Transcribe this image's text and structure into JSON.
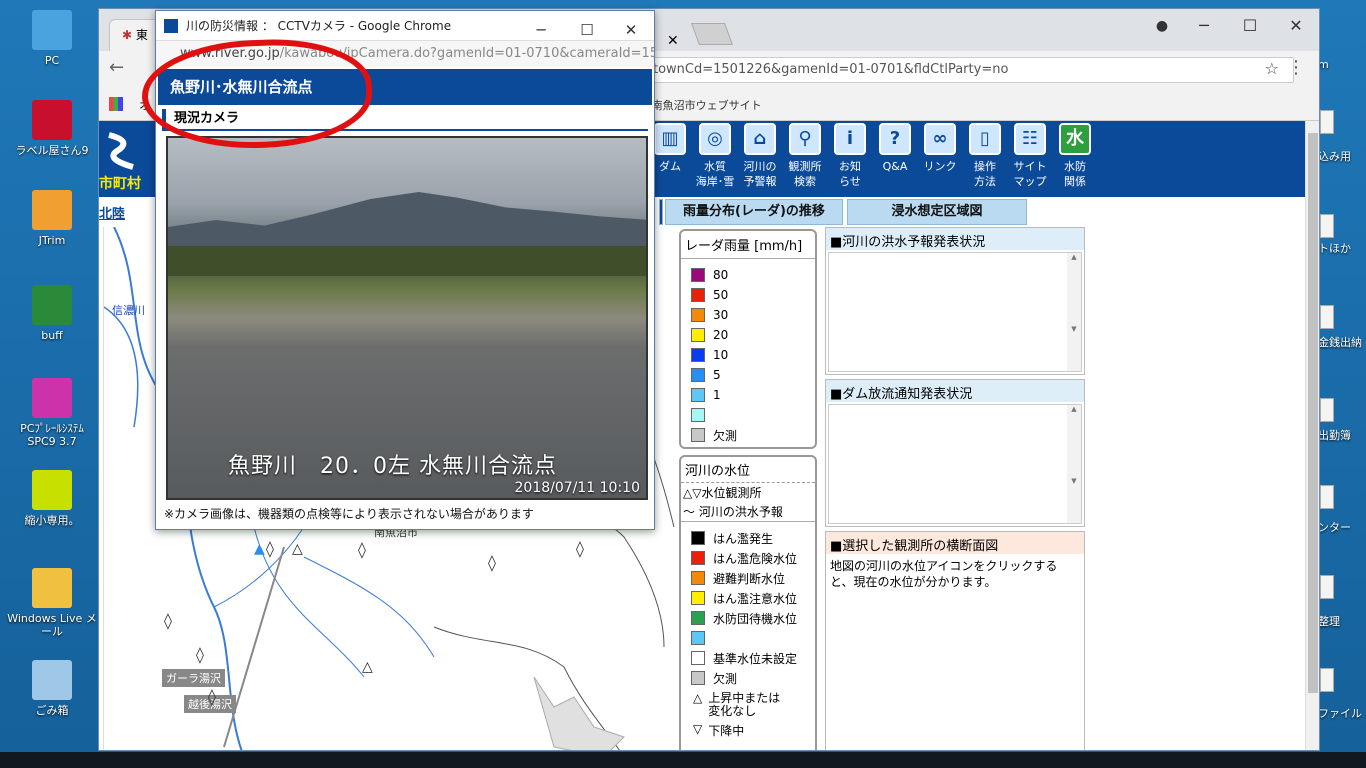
{
  "desktop": {
    "icons": [
      {
        "label": "PC",
        "color": "#4aa3df"
      },
      {
        "label": "ラベル屋さん9",
        "color": "#c8102e"
      },
      {
        "label": "JTrim",
        "color": "#f0a030"
      },
      {
        "label": "buff",
        "color": "#2a8a3a"
      },
      {
        "label": "PCﾌﾟﾚｰﾙｼｽﾃﾑ SPC9 3.7",
        "color": "#cc33aa"
      },
      {
        "label": "縮小専用。",
        "color": "#c8e000"
      },
      {
        "label": "Windows Live メール",
        "color": "#f0c040"
      },
      {
        "label": "ごみ箱",
        "color": "#9ec7e8"
      }
    ],
    "right_labels": [
      "込み用",
      "トほか",
      "金銭出納",
      "出勤簿",
      "ンター",
      "整理",
      "ファイル",
      "m"
    ]
  },
  "browser": {
    "tab1_label": "東",
    "url_tail": "townCd=1501226&gamenId=01-0701&fldCtlParty=no",
    "bookmark": "南魚沼市ウェブサイト",
    "bookmark_prefix": "オ"
  },
  "site": {
    "city_label": "市町村",
    "breadcrumb": "北陸",
    "nav": [
      {
        "label": "ダム",
        "icon": "dam-icon",
        "glyph": "▥"
      },
      {
        "label": "水質\n海岸･雪",
        "icon": "magnify-water-icon",
        "glyph": "◎"
      },
      {
        "label": "河川の\n予警報",
        "icon": "house-alert-icon",
        "glyph": "⌂"
      },
      {
        "label": "観測所\n検索",
        "icon": "search-icon",
        "glyph": "⚲"
      },
      {
        "label": "お知\nらせ",
        "icon": "info-icon",
        "glyph": "i"
      },
      {
        "label": "Q&A",
        "icon": "question-icon",
        "glyph": "?"
      },
      {
        "label": "リンク",
        "icon": "link-icon",
        "glyph": "∞"
      },
      {
        "label": "操作\n方法",
        "icon": "mouse-icon",
        "glyph": "▯"
      },
      {
        "label": "サイト\nマップ",
        "icon": "sitemap-icon",
        "glyph": "☷"
      },
      {
        "label": "水防\n関係",
        "icon": "suibou-icon",
        "glyph": "水"
      }
    ],
    "tabs": [
      "雨量分布(レーダ)の推移",
      "浸水想定区域図"
    ],
    "radar_legend": {
      "title": "レーダ雨量 [mm/h]",
      "items": [
        {
          "label": "80",
          "color": "#9b0a7a"
        },
        {
          "label": "50",
          "color": "#e8200c"
        },
        {
          "label": "30",
          "color": "#f2890b"
        },
        {
          "label": "20",
          "color": "#ffee00"
        },
        {
          "label": "10",
          "color": "#0a3cf0"
        },
        {
          "label": "5",
          "color": "#2a8df0"
        },
        {
          "label": "1",
          "color": "#5ec8f5"
        },
        {
          "label": "",
          "color": "#a8f5f5"
        },
        {
          "label": "欠測",
          "color": "#c8c8c8"
        }
      ]
    },
    "river_legend": {
      "title": "河川の水位",
      "obs": "△▽水位観測所",
      "forecast": "〜 河川の洪水予報",
      "items": [
        {
          "label": "はん濫発生",
          "color": "#000000"
        },
        {
          "label": "はん濫危険水位",
          "color": "#e8200c"
        },
        {
          "label": "避難判断水位",
          "color": "#f2890b"
        },
        {
          "label": "はん濫注意水位",
          "color": "#ffee00"
        },
        {
          "label": "水防団待機水位",
          "color": "#2aa050"
        },
        {
          "label": "",
          "color": "#5ec8f5"
        },
        {
          "label": "基準水位未設定",
          "color": "#ffffff"
        },
        {
          "label": "欠測",
          "color": "#c8c8c8"
        }
      ],
      "rising": "上昇中または\n変化なし",
      "falling": "下降中"
    },
    "panels": {
      "flood": "■河川の洪水予報発表状況",
      "dam": "■ダム放流通知発表状況",
      "section": "■選択した観測所の横断面図",
      "section_text": "地図の河川の水位アイコンをクリックすると、現在の水位が分かります。"
    },
    "map": {
      "labels": [
        "信濃川",
        "ガーラ湯沢",
        "越後湯沢",
        "南魚沼市"
      ]
    }
  },
  "popup": {
    "title": "川の防災情報 ： CCTVカメラ - Google Chrome",
    "url_host": "www.river.go.jp",
    "url_path": "/kawabou/ipCamera.do?gamenId=01-0710&cameraId=15...",
    "header": "魚野川･水無川合流点",
    "section": "現況カメラ",
    "cam_caption": "魚野川　20．0左 水無川合流点",
    "cam_datetime": "2018/07/11 10:10",
    "note": "※カメラ画像は、機器類の点検等により表示されない場合があります"
  }
}
